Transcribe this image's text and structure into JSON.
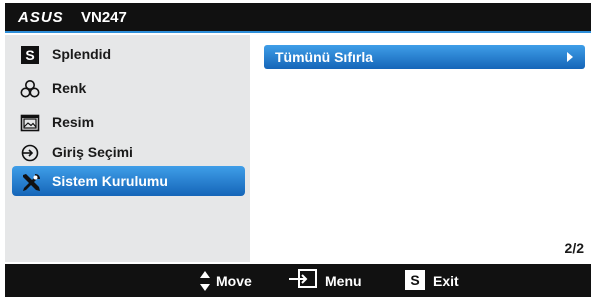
{
  "header": {
    "brand": "ASUS",
    "model": "VN247"
  },
  "sidebar": {
    "items": [
      {
        "label": "Splendid",
        "icon": "splendid-s-icon",
        "selected": false
      },
      {
        "label": "Renk",
        "icon": "color-circles-icon",
        "selected": false
      },
      {
        "label": "Resim",
        "icon": "image-icon",
        "selected": false
      },
      {
        "label": "Giriş Seçimi",
        "icon": "input-select-icon",
        "selected": false
      },
      {
        "label": "Sistem Kurulumu",
        "icon": "tools-icon",
        "selected": true
      }
    ]
  },
  "main": {
    "submenu": [
      {
        "label": "Tümünü Sıfırla",
        "icon": "chevron-right-icon"
      }
    ],
    "page_indicator": "2/2"
  },
  "footer": {
    "move_label": "Move",
    "menu_label": "Menu",
    "exit_label": "Exit"
  },
  "colors": {
    "titlebar_bg": "#111111",
    "accent_blue": "#2f8fd9",
    "sidebar_bg": "#e6e7e8",
    "selected_gradient_top": "#3f9ee8",
    "selected_gradient_bottom": "#1565b8"
  }
}
